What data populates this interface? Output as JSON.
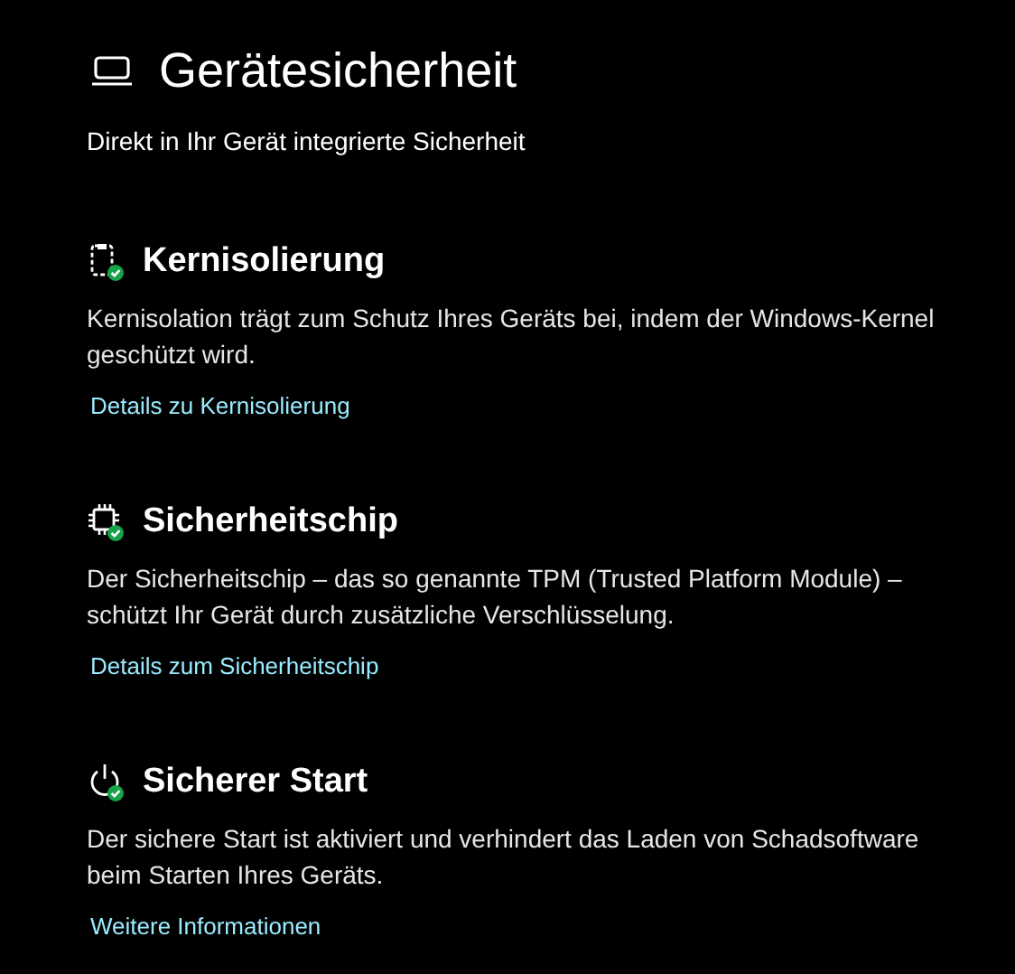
{
  "page": {
    "title": "Gerätesicherheit",
    "subtitle": "Direkt in Ihr Gerät integrierte Sicherheit"
  },
  "sections": [
    {
      "kind": "memory",
      "protected": true,
      "heading": "Kernisolierung",
      "description": "Kernisolation trägt zum Schutz Ihres Geräts bei, indem der Windows-Kernel geschützt wird.",
      "link": "Details zu Kernisolierung"
    },
    {
      "kind": "chip",
      "protected": true,
      "heading": "Sicherheitschip",
      "description": "Der Sicherheitschip – das so genannte TPM (Trusted Platform Module) – schützt Ihr Gerät durch zusätzliche Verschlüsselung.",
      "link": "Details zum Sicherheitschip"
    },
    {
      "kind": "power",
      "protected": true,
      "heading": "Sicherer Start",
      "description": "Der sichere Start ist aktiviert und verhindert das Laden von Schadsoftware beim Starten Ihres Geräts.",
      "link": "Weitere Informationen"
    }
  ]
}
